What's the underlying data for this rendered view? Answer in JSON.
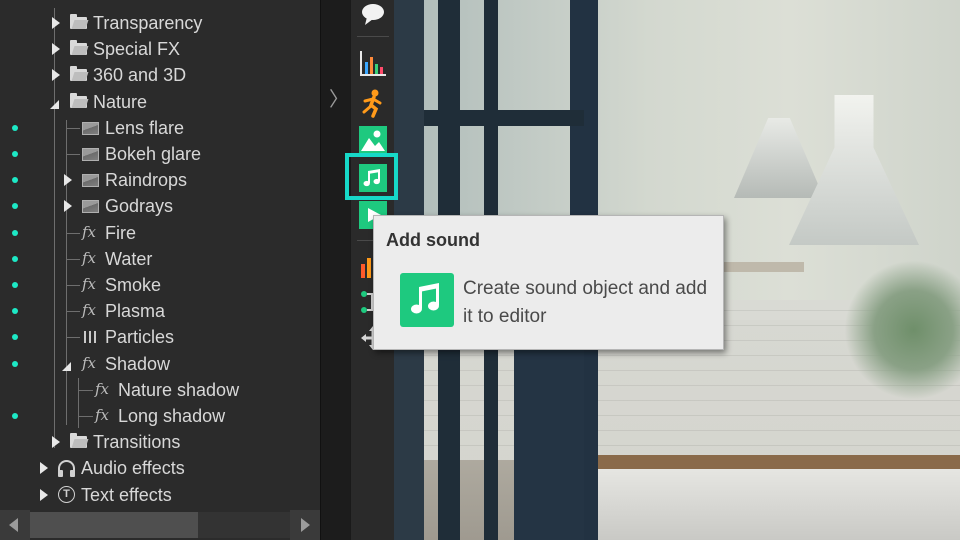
{
  "tree": {
    "items": [
      {
        "label": "Transparency",
        "icon": "folder-icon",
        "expander": "collapsed"
      },
      {
        "label": "Special FX",
        "icon": "folder-icon",
        "expander": "collapsed"
      },
      {
        "label": "360 and 3D",
        "icon": "folder-icon",
        "expander": "collapsed"
      },
      {
        "label": "Nature",
        "icon": "folder-icon",
        "expander": "expanded"
      },
      {
        "label": "Lens flare",
        "icon": "image-effect-icon",
        "expander": "none"
      },
      {
        "label": "Bokeh glare",
        "icon": "image-effect-icon",
        "expander": "none"
      },
      {
        "label": "Raindrops",
        "icon": "image-effect-icon",
        "expander": "collapsed"
      },
      {
        "label": "Godrays",
        "icon": "image-effect-icon",
        "expander": "collapsed"
      },
      {
        "label": "Fire",
        "icon": "fx-icon",
        "expander": "none"
      },
      {
        "label": "Water",
        "icon": "fx-icon",
        "expander": "none"
      },
      {
        "label": "Smoke",
        "icon": "fx-icon",
        "expander": "none"
      },
      {
        "label": "Plasma",
        "icon": "fx-icon",
        "expander": "none"
      },
      {
        "label": "Particles",
        "icon": "particles-icon",
        "expander": "none"
      },
      {
        "label": "Shadow",
        "icon": "fx-icon",
        "expander": "expanded"
      },
      {
        "label": "Nature shadow",
        "icon": "fx-icon",
        "expander": "none"
      },
      {
        "label": "Long shadow",
        "icon": "fx-icon",
        "expander": "none"
      },
      {
        "label": "Transitions",
        "icon": "folder-icon",
        "expander": "collapsed"
      },
      {
        "label": "Audio effects",
        "icon": "headphones-icon",
        "expander": "collapsed"
      },
      {
        "label": "Text effects",
        "icon": "text-circle-icon",
        "expander": "collapsed"
      }
    ],
    "fx_glyph": "fx",
    "text_glyph": "T"
  },
  "splitter": {
    "collapse_glyph": "〉"
  },
  "toolbar": {
    "buttons": [
      {
        "name": "comment-icon"
      },
      {
        "name": "chart-icon"
      },
      {
        "name": "animation-figure-icon"
      },
      {
        "name": "image-icon"
      },
      {
        "name": "music-note-icon",
        "highlighted": true
      },
      {
        "name": "video-play-icon"
      },
      {
        "name": "equalizer-icon"
      },
      {
        "name": "connections-icon"
      },
      {
        "name": "move-icon"
      }
    ]
  },
  "tooltip": {
    "title": "Add sound",
    "description": "Create sound object and add it to editor",
    "icon": "music-note-icon"
  },
  "colors": {
    "accent_cyan": "#17d9c8",
    "sound_green": "#1ec97f",
    "tree_dot": "#1de9c6",
    "panel_bg": "#2b2b2b"
  }
}
